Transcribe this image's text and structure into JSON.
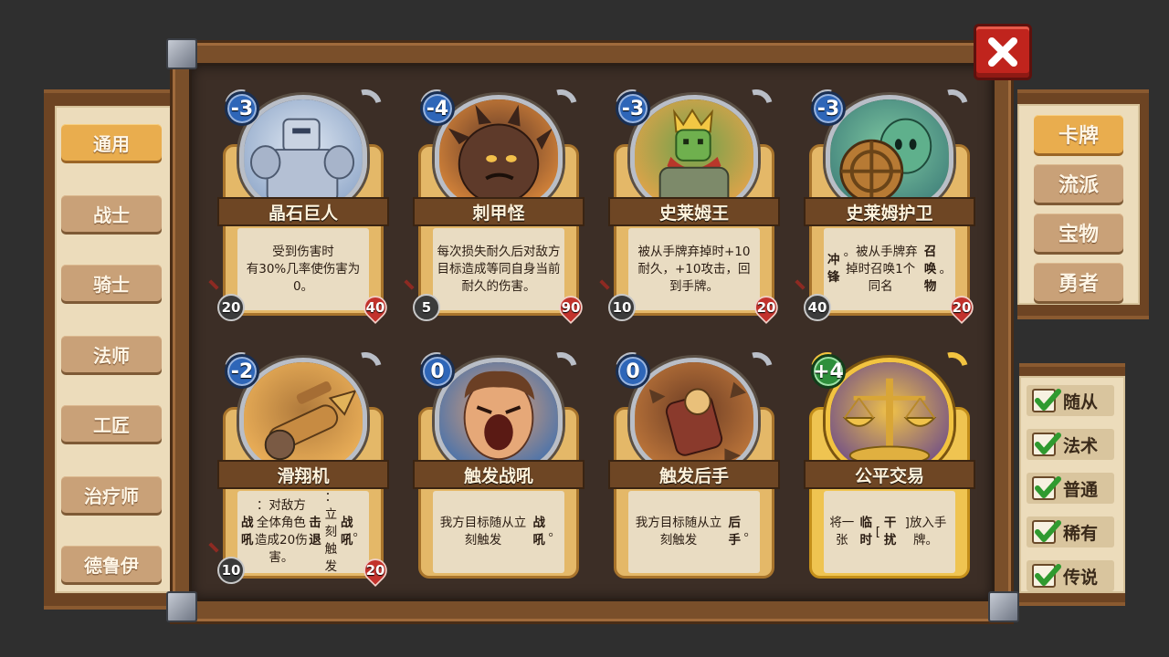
{
  "close_button": {
    "icon": "close-x-icon"
  },
  "categories": [
    {
      "label": "通用",
      "active": true
    },
    {
      "label": "战士",
      "active": false
    },
    {
      "label": "骑士",
      "active": false
    },
    {
      "label": "法师",
      "active": false
    },
    {
      "label": "工匠",
      "active": false
    },
    {
      "label": "治疗师",
      "active": false
    },
    {
      "label": "德鲁伊",
      "active": false
    }
  ],
  "types": [
    {
      "label": "卡牌",
      "active": true
    },
    {
      "label": "流派",
      "active": false
    },
    {
      "label": "宝物",
      "active": false
    },
    {
      "label": "勇者",
      "active": false
    }
  ],
  "filters": [
    {
      "label": "随从",
      "checked": true
    },
    {
      "label": "法术",
      "checked": true
    },
    {
      "label": "普通",
      "checked": true
    },
    {
      "label": "稀有",
      "checked": true
    },
    {
      "label": "传说",
      "checked": true
    }
  ],
  "cards": [
    {
      "name": "晶石巨人",
      "cost": "-3",
      "desc_html": "受到伤害时<br>有30%几率使伤害为0。",
      "attack": "20",
      "health": "40",
      "art": "crystal-golem",
      "colors": [
        "#8fa7c9",
        "#dfe7f1",
        "#6b7f9c"
      ]
    },
    {
      "name": "刺甲怪",
      "cost": "-4",
      "desc_html": "每次损失耐久后对敌方目标造成等同自身当前耐久的伤害。",
      "attack": "5",
      "health": "90",
      "art": "spike-beast",
      "colors": [
        "#e08b3b",
        "#5a3527",
        "#b55b2a"
      ]
    },
    {
      "name": "史莱姆王",
      "cost": "-3",
      "desc_html": "被从手牌弃掉时+10耐久，+10攻击，回到手牌。",
      "attack": "10",
      "health": "20",
      "art": "slime-king",
      "colors": [
        "#e9a34a",
        "#6fa24c",
        "#8c3b2a"
      ]
    },
    {
      "name": "史莱姆护卫",
      "cost": "-3",
      "desc_html": "<b>冲锋</b>。被从手牌弃掉时召唤1个同名<b>召唤物</b>。",
      "attack": "40",
      "health": "20",
      "art": "slime-guard",
      "colors": [
        "#3f7f7a",
        "#7ec7a0",
        "#c58c3c"
      ]
    },
    {
      "name": "滑翔机",
      "cost": "-2",
      "desc_html": "<b>战吼</b>：对敌方全体角色造成20伤害。<br><b>击退</b>：立刻触发<b>战吼</b>。",
      "attack": "10",
      "health": "20",
      "art": "glider",
      "colors": [
        "#f0b45b",
        "#b07a3c",
        "#6d5a48"
      ]
    },
    {
      "name": "触发战吼",
      "cost": "0",
      "desc_html": "我方目标随从立刻触发<b>战吼</b>。",
      "attack": "",
      "health": "",
      "art": "war-cry",
      "colors": [
        "#3d6fb0",
        "#e4a071",
        "#7a4a2c"
      ]
    },
    {
      "name": "触发后手",
      "cost": "0",
      "desc_html": "我方目标随从立刻触发<b>后手</b>。",
      "attack": "",
      "health": "",
      "art": "aftermath",
      "colors": [
        "#c37a3c",
        "#6b3c24",
        "#e8c27a"
      ]
    },
    {
      "name": "公平交易",
      "cost": "+4",
      "desc_html": "将一张<b>临时</b>[<b>干扰</b>]放入手牌。",
      "attack": "",
      "health": "",
      "art": "scales",
      "colors": [
        "#6b4a8a",
        "#f0c24a",
        "#3b2a52"
      ]
    }
  ]
}
